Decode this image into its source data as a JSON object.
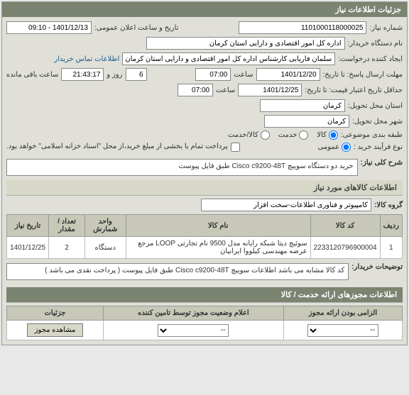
{
  "panel_title": "جزئیات اطلاعات نیاز",
  "top": {
    "need_no_label": "شماره نیاز:",
    "need_no": "1101000118000025",
    "announce_label": "تاریخ و ساعت اعلان عمومی:",
    "announce_val": "1401/12/13 - 09:10",
    "buyer_org_label": "نام دستگاه خریدار:",
    "buyer_org": "اداره کل امور اقتصادی و دارایی استان کرمان",
    "creator_label": "ایجاد کننده درخواست:",
    "creator": "سلمان فاریابی کارشناس اداره کل امور اقتصادی و دارایی استان کرمان",
    "contact_link": "اطلاعات تماس خریدار",
    "reply_deadline_label": "مهلت ارسال پاسخ: تا تاریخ:",
    "reply_date": "1401/12/20",
    "time_label": "ساعت",
    "reply_hour": "07:00",
    "day_label": "روز و",
    "day_val": "6",
    "remain_label": "ساعت باقی مانده",
    "remain_val": "21:43:17",
    "min_valid_label": "حداقل تاریخ اعتبار قیمت: تا تاریخ:",
    "valid_date": "1401/12/25",
    "valid_hour": "07:00",
    "need_city_label": "استان محل تحویل:",
    "need_city": "کرمان",
    "deliver_city_label": "شهر محل تحویل:",
    "deliver_city": "کرمان",
    "cat_label": "طبقه بندی موضوعی:",
    "cat_goods": "کالا",
    "cat_service": "خدمت",
    "cat_both": "کالا/خدمت",
    "buy_type_label": "نوع فرآیند خرید :",
    "buy_type_open": "عمومی",
    "partial_pay": "پرداخت تمام یا بخشی از مبلغ خرید،از محل \"اسناد خزانه اسلامی\" خواهد بود."
  },
  "desc": {
    "header_label": "شرح کلی نیاز:",
    "text": "خرید دو دستگاه سوییچ Cisco c9200-48T طبق فایل پیوست"
  },
  "items_section": {
    "title": "اطلاعات کالاهای مورد نیاز",
    "group_label": "گروه کالا:",
    "group_val": "کامپیوتر و فناوری اطلاعات-سخت افزار",
    "cols": {
      "row": "ردیف",
      "code": "کد کالا",
      "name": "نام کالا",
      "unit": "واحد شمارش",
      "qty": "تعداد / مقدار",
      "need_date": "تاریخ نیاز"
    },
    "rows": [
      {
        "row": "1",
        "code": "2233120796900004",
        "name": "سوئیچ دیتا شبکه رایانه مدل 9500 نام تجارتی LOOP مرجع عرضه مهندسی کیلووا ایرانیان",
        "unit": "دستگاه",
        "qty": "2",
        "need_date": "1401/12/25"
      }
    ],
    "buyer_notes_label": "توضیحات خریدار:",
    "buyer_notes": "کد کالا مشابه می باشد اطلاعات سوییچ Cisco c9200-48T طبق فایل پیوست ( پرداخت نقدی می باشد )"
  },
  "bottom": {
    "section_title": "اطلاعات مجوزهای ارائه خدمت / کالا",
    "mandatory_label": "الزامی بودن ارائه مجوز",
    "status_label": "اعلام وضعیت مجوز توسط تامین کننده",
    "details_label": "جزئیات",
    "view_btn": "مشاهده مجوز",
    "sel_default": "--"
  }
}
